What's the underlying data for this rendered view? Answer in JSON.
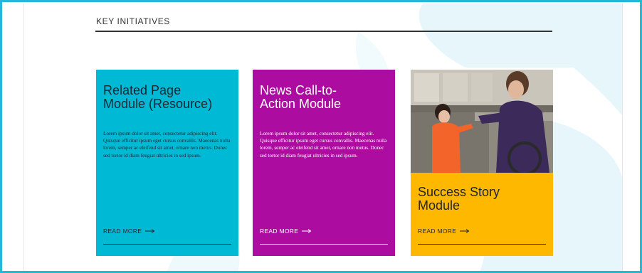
{
  "section": {
    "title": "KEY INITIATIVES"
  },
  "cards": [
    {
      "title_line1": "Related Page",
      "title_line2": "Module (Resource)",
      "body": "Lorem ipsum dolor sit amet, consectetur adipiscing elit. Quisque efficitur ipsum eget cursus convallis. Maecenas nulla lorem, semper ac eleifend sit amet, ornare non metus. Donec sed tortor id diam feugiat ultricies in sed ipsum.",
      "read_more": "READ MORE",
      "color": "#00b9d4"
    },
    {
      "title_line1": "News Call-to-",
      "title_line2": "Action Module",
      "body": "Lorem ipsum dolor sit amet, consectetur adipiscing elit. Quisque efficitur ipsum eget cursus convallis. Maecenas nulla lorem, semper ac eleifend sit amet, ornare non metus. Donec sed tortor id diam feugiat ultricies in sed ipsum.",
      "read_more": "READ MORE",
      "color": "#ad0ca0"
    },
    {
      "title_line1": "Success Story",
      "title_line2": "Module",
      "read_more": "READ MORE",
      "color": "#ffb800"
    }
  ],
  "colors": {
    "frame_border": "#22b8d6",
    "rule": "#333333",
    "bg_shape": "#e6f6fa"
  }
}
